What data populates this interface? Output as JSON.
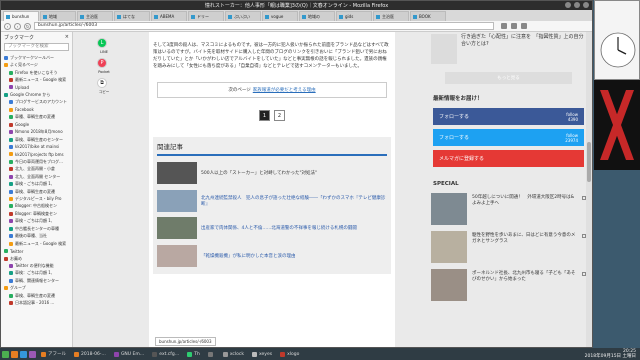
{
  "window": {
    "title": "憧れストーカー：他人事形「親は職業]3の(Q)｜文春オンライン - Mozilla Firefox"
  },
  "tabs": [
    "bunshun",
    "地域",
    "主治医",
    "はてな",
    "ABEMA",
    "ドリー",
    "ぶいぶい",
    "vogue",
    "地域の",
    "gids",
    "主治医",
    "BOOK"
  ],
  "url": "bunshun.jp/articles/-/6003",
  "sidebar": {
    "title": "ブックマーク",
    "search_placeholder": "ブックマークを検索",
    "items": [
      "ブックマークツールバー",
      "よく見るページ",
      "Firefox を使いこなそう",
      "最新ニュース - Google 検索",
      "Upload",
      "Google Chrome から",
      "ブログサービスのアカウント",
      "Facebook",
      "車種、車輌生産の変遷",
      "Google",
      "Nmono 2018年8月mono",
      "車検、車輌生産のセンター",
      "kk2017/bike at mainsi",
      "kk2017/projects ftp bms",
      "今日の車両運用をブログ…",
      "北九、全面再開・小倉",
      "北九、全面再開 センター",
      "車検・ごちは月額 1,",
      "車検、車輌生産の変遷",
      "デジタルピース・bily Pro",
      "Blogger: 中古船検セン",
      "Blogger: 車輌検査セン",
      "車検・ごちは月額 1,",
      "中古艦長センターの車種",
      "最後の車種、当社",
      "最新ニュース - Google 検索",
      "Twitter",
      "お薦め",
      "Twitter の便利な機能",
      "車検：ごちは月額 1,",
      "車輌、関連情報センター",
      "グループ",
      "車検、車輌生産の変遷",
      "日本語記事 - 2016 ..."
    ]
  },
  "share": {
    "line": "LINE",
    "pocket": "Pocket",
    "copy": "コピー"
  },
  "article": {
    "paragraphs": [
      "そして3度目の殺人は、マスコミによるものです。彼は一方的に犯人扱いか振られた前面をブランド品などはすべて政策はいるのですが。バイト先を取材サイドに購入した年間のブログのリンクを引きおいに「ブランド狙いで男におねだりしていた」とか「いかがわしい店でアルバイトをしていた」などと事実無根の話を報じられました。遺族の親権を踏みみにして「女性にも落ち度がある」「自業自得」などとテレビで話すコメンテーターもいました。"
    ],
    "next_label": "次のページ",
    "next_link": "家族報道が必要だと考える理由",
    "pages": [
      "1",
      "2"
    ],
    "related_title": "関連記事",
    "related": [
      {
        "title": "500人以上の「ストーカー」と対峙してわかった\"対処法\"",
        "blue": false
      },
      {
        "title": "北九州連続監禁殺人　犯人の息子が語った壮絶な経験――「わずかのスマホ『テレビ健康診断』",
        "blue": true
      },
      {
        "title": "出産家で肉体関係、4人と不倫……北海道警の不祥事を報じ続ける札幌の闘闘",
        "blue": true
      },
      {
        "title": "「乾燥機殺機」が私に明かした本音と涙の理由",
        "blue": true
      }
    ]
  },
  "status_url": "bunshun.jp/articles/-/6003",
  "right": {
    "card_title": "行き過ぎた「心配性」に注意を　「指図性質」上の自分合い方とは?",
    "more_label": "もっと見る",
    "latest_title": "最新情報をお届け！",
    "follows": [
      {
        "label": "フォローする",
        "count_label": "follow",
        "count": "4390",
        "color": "#3b5998"
      },
      {
        "label": "フォローする",
        "count_label": "follow",
        "count": "23974",
        "color": "#1da1f2"
      },
      {
        "label": "メルマガに登録する",
        "count_label": "",
        "count": "",
        "color": "#e53935"
      }
    ],
    "special_title": "SPECIAL",
    "specials": [
      "50年越しについに開通！　外環道大阪区2時号は&よみよ上手へ",
      "駆性を野性を歩いあまに、日はどに有意う今意のメガネとサングラス",
      "ポーネルンド社長、北九州市も寝る「子ども「あそびのせかい」から始まった"
    ]
  },
  "taskbar": {
    "tasks": [
      "アフール",
      "2018-06-…",
      "GNU Em…",
      "ext.cfg…",
      "Th",
      "",
      "xclock",
      "xeyes",
      "xlogo"
    ],
    "time": "20:25",
    "date": "2018年09月15日 土曜日"
  }
}
